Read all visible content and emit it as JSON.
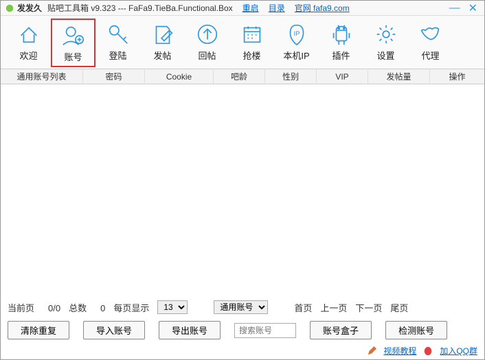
{
  "titlebar": {
    "app_name": "发发久",
    "app_sub": "贴吧工具箱 v9.323 --- FaFa9.TieBa.Functional.Box",
    "restart": "重启",
    "catalog": "目录",
    "official": "官网 fafa9.com"
  },
  "toolbar": [
    {
      "id": "welcome",
      "label": "欢迎"
    },
    {
      "id": "account",
      "label": "账号"
    },
    {
      "id": "login",
      "label": "登陆"
    },
    {
      "id": "post",
      "label": "发帖"
    },
    {
      "id": "reply",
      "label": "回帖"
    },
    {
      "id": "grab",
      "label": "抢楼"
    },
    {
      "id": "ip",
      "label": "本机IP"
    },
    {
      "id": "plugin",
      "label": "插件"
    },
    {
      "id": "settings",
      "label": "设置"
    },
    {
      "id": "proxy",
      "label": "代理"
    }
  ],
  "columns": [
    {
      "label": "通用账号列表",
      "w": 120
    },
    {
      "label": "密码",
      "w": 80
    },
    {
      "label": "Cookie",
      "w": 90
    },
    {
      "label": "吧龄",
      "w": 70
    },
    {
      "label": "性别",
      "w": 70
    },
    {
      "label": "VIP",
      "w": 70
    },
    {
      "label": "发帖量",
      "w": 90
    },
    {
      "label": "操作",
      "w": 80
    }
  ],
  "pager": {
    "current_label": "当前页",
    "current": "0/0",
    "total_label": "总数",
    "total": "0",
    "pagesize_label": "每页显示",
    "pagesize": "13",
    "filter": "通用账号",
    "first": "首页",
    "prev": "上一页",
    "next": "下一页",
    "last": "尾页"
  },
  "actions": {
    "clear": "清除重复",
    "import": "导入账号",
    "export": "导出账号",
    "search_ph": "搜索账号",
    "box": "账号盒子",
    "check": "检测账号"
  },
  "footer": {
    "video": "视频教程",
    "qq": "加入QQ群"
  }
}
